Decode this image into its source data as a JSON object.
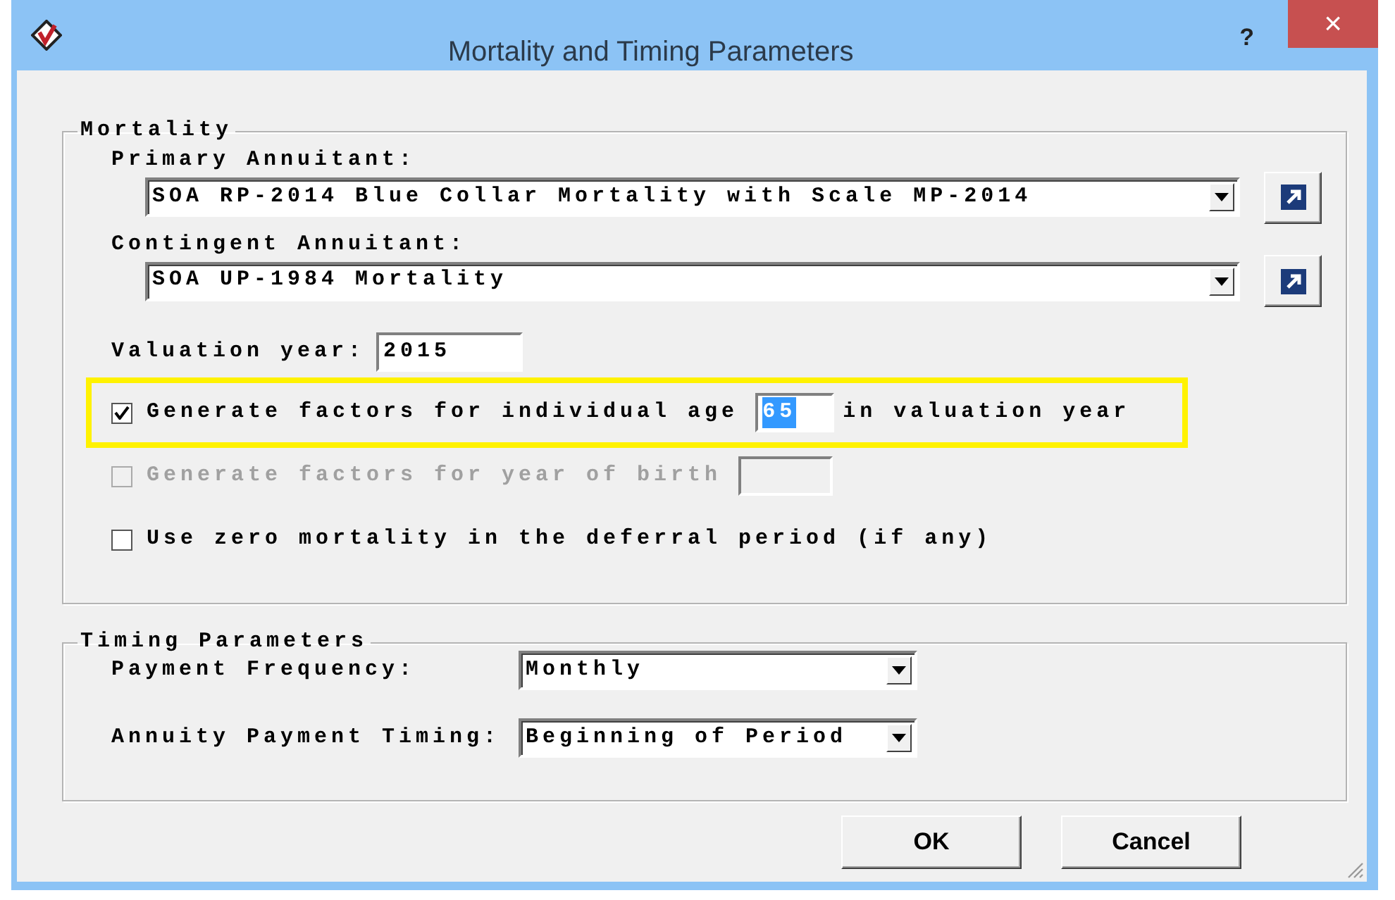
{
  "window": {
    "title": "Mortality and Timing Parameters",
    "help": "?",
    "close": "×"
  },
  "mortality": {
    "legend": "Mortality",
    "selectors": [
      {
        "label": "Primary Annuitant:",
        "value": "SOA RP-2014 Blue Collar Mortality with Scale MP-2014"
      },
      {
        "label": "Contingent Annuitant:",
        "value": "SOA UP-1984 Mortality"
      }
    ],
    "valuation_year": {
      "label": "Valuation year:",
      "value": "2015"
    },
    "options": [
      {
        "kind": "age",
        "label": "Generate factors for individual age",
        "value": "65",
        "value_selected": true,
        "suffix": "in valuation year",
        "checked": true,
        "disabled": false,
        "highlighted": true
      },
      {
        "kind": "birth",
        "label": "Generate factors for year of birth",
        "checked": false,
        "disabled": true,
        "highlighted": false
      },
      {
        "kind": "plain",
        "label": "Use zero mortality in the deferral period (if any)",
        "checked": false,
        "disabled": false,
        "highlighted": false
      }
    ]
  },
  "timing": {
    "legend": "Timing Parameters",
    "fields": [
      {
        "label": "Payment Frequency:",
        "value": "Monthly"
      },
      {
        "label": "Annuity Payment Timing:",
        "value": "Beginning of Period"
      }
    ]
  },
  "buttons": [
    {
      "label": "OK"
    },
    {
      "label": "Cancel"
    }
  ]
}
